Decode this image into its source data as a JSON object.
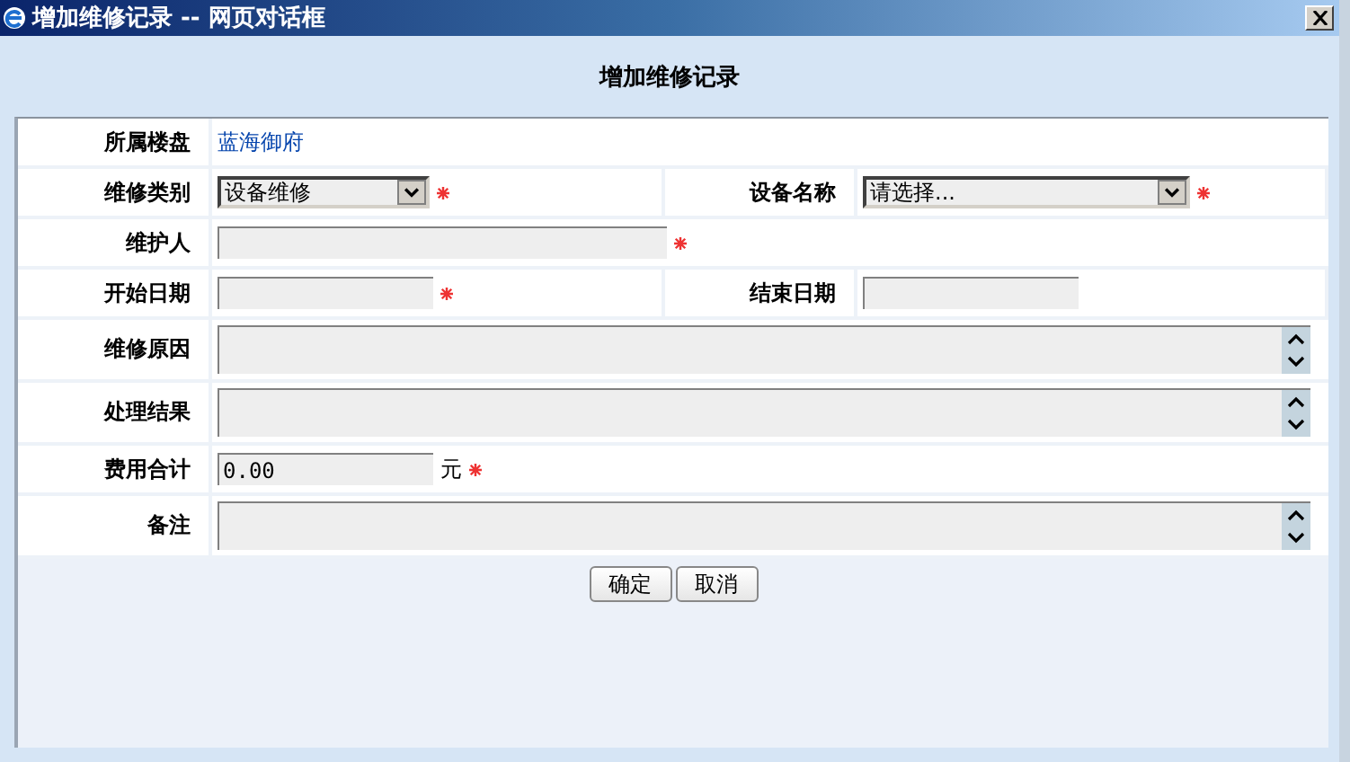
{
  "window": {
    "title": "增加维修记录 -- 网页对话框"
  },
  "heading": "增加维修记录",
  "rows": [
    {
      "fields": [
        {
          "label": "所属楼盘",
          "kind": "link",
          "value": "蓝海御府",
          "required": false
        }
      ]
    },
    {
      "fields": [
        {
          "label": "维修类别",
          "kind": "select",
          "value": "设备维修",
          "required": true
        },
        {
          "label": "设备名称",
          "kind": "select-wide",
          "value": "请选择...",
          "required": true
        }
      ]
    },
    {
      "fields": [
        {
          "label": "维护人",
          "kind": "input-wide",
          "required": true
        }
      ]
    },
    {
      "fields": [
        {
          "label": "开始日期",
          "kind": "input",
          "required": true
        },
        {
          "label": "结束日期",
          "kind": "input",
          "required": false
        }
      ]
    },
    {
      "fields": [
        {
          "label": "维修原因",
          "kind": "textarea",
          "required": false
        }
      ]
    },
    {
      "fields": [
        {
          "label": "处理结果",
          "kind": "textarea",
          "required": false
        }
      ]
    },
    {
      "fields": [
        {
          "label": "费用合计",
          "kind": "input",
          "value": "0.00",
          "suffix": "元",
          "required": true
        }
      ]
    },
    {
      "fields": [
        {
          "label": "备注",
          "kind": "textarea",
          "required": false
        }
      ]
    }
  ],
  "buttons": [
    "确定",
    "取消"
  ]
}
